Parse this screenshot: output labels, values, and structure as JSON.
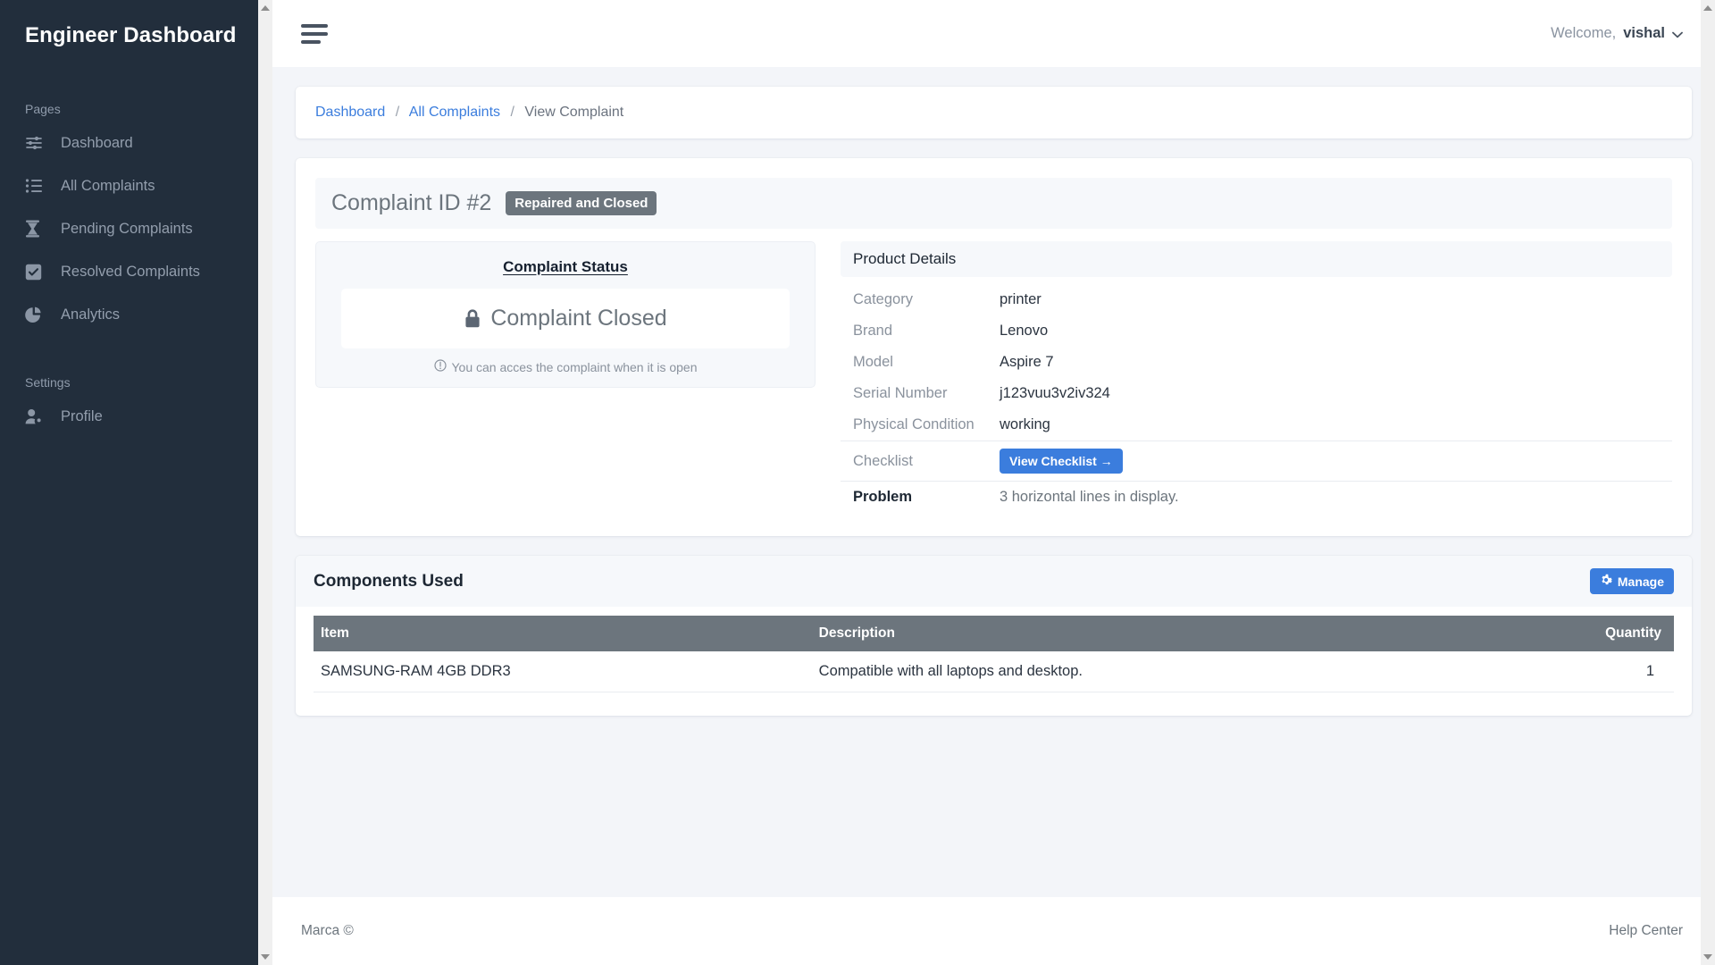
{
  "sidebar": {
    "brand": "Engineer Dashboard",
    "sections": [
      {
        "title": "Pages",
        "items": [
          {
            "label": "Dashboard",
            "icon": "sliders-icon"
          },
          {
            "label": "All Complaints",
            "icon": "list-icon"
          },
          {
            "label": "Pending Complaints",
            "icon": "hourglass-icon"
          },
          {
            "label": "Resolved Complaints",
            "icon": "check-square-icon"
          },
          {
            "label": "Analytics",
            "icon": "pie-chart-icon"
          }
        ]
      },
      {
        "title": "Settings",
        "items": [
          {
            "label": "Profile",
            "icon": "user-gear-icon"
          }
        ]
      }
    ]
  },
  "topbar": {
    "menu_icon": "hamburger-icon",
    "welcome_label": "Welcome,",
    "username": "vishal",
    "chevron": "⌄"
  },
  "breadcrumb": {
    "items": [
      {
        "label": "Dashboard",
        "link": true
      },
      {
        "label": "All Complaints",
        "link": true
      },
      {
        "label": "View Complaint",
        "link": false
      }
    ],
    "separator": "/"
  },
  "complaint": {
    "title": "Complaint ID #2",
    "status_badge": "Repaired and Closed",
    "status_panel": {
      "heading": "Complaint Status",
      "lock_icon": "lock-icon",
      "status_text": "Complaint Closed",
      "hint_icon": "info-circle-icon",
      "hint": "You can acces the complaint when it is open"
    },
    "product_details": {
      "heading": "Product Details",
      "rows": [
        {
          "key": "Category",
          "value": "printer"
        },
        {
          "key": "Brand",
          "value": "Lenovo"
        },
        {
          "key": "Model",
          "value": "Aspire 7"
        },
        {
          "key": "Serial Number",
          "value": "j123vuu3v2iv324"
        },
        {
          "key": "Physical Condition",
          "value": "working"
        }
      ],
      "checklist_key": "Checklist",
      "checklist_button": "View Checklist →",
      "problem_key": "Problem",
      "problem_value": "3 horizontal lines in display."
    }
  },
  "components": {
    "title": "Components Used",
    "manage_button": "Manage",
    "manage_icon": "gear-icon",
    "columns": [
      "Item",
      "Description",
      "Quantity"
    ],
    "rows": [
      {
        "item": "SAMSUNG-RAM 4GB DDR3",
        "description": "Compatible with all laptops and desktop.",
        "quantity": "1"
      }
    ]
  },
  "footer": {
    "left": "Marca ©",
    "right": "Help Center"
  },
  "colors": {
    "sidebar_bg": "#222e3c",
    "content_bg": "#f3f5f9",
    "accent_blue": "#3b7ddd",
    "badge_gray": "#6c757d",
    "table_header": "#6c757d"
  }
}
